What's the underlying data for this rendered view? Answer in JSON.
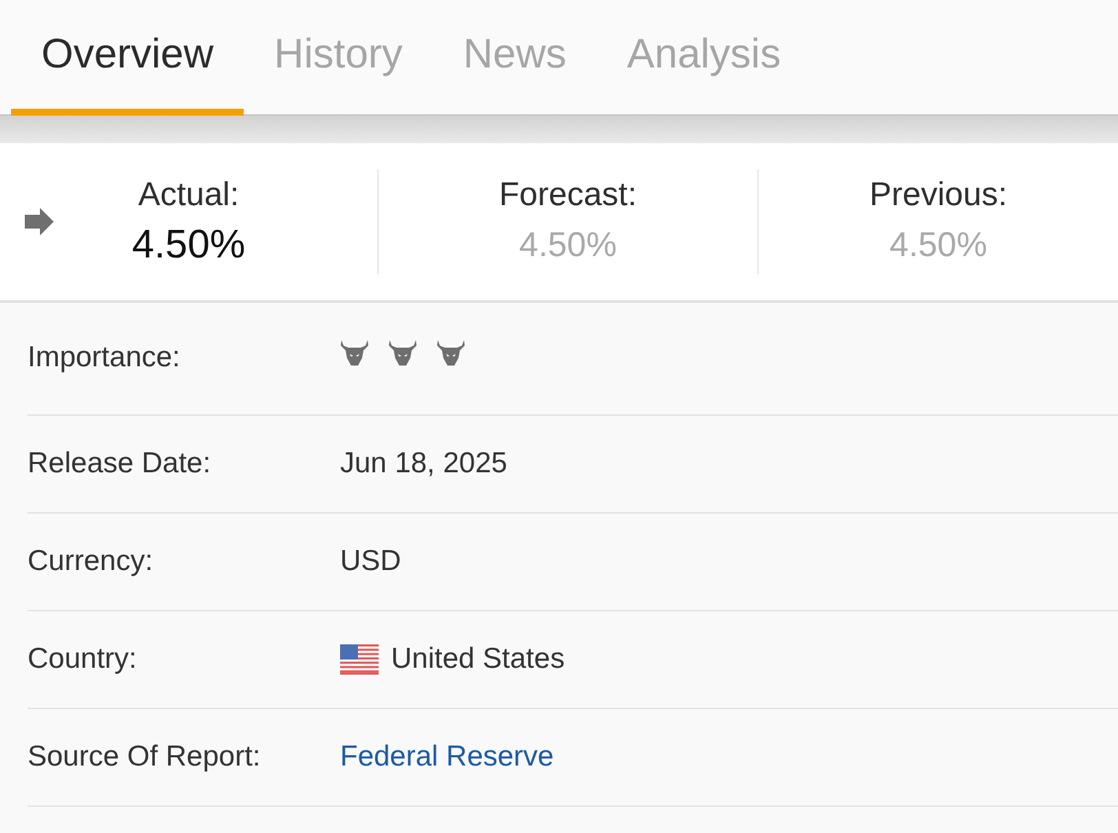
{
  "tabs": [
    {
      "label": "Overview",
      "selected": true
    },
    {
      "label": "History",
      "selected": false
    },
    {
      "label": "News",
      "selected": false
    },
    {
      "label": "Analysis",
      "selected": false
    }
  ],
  "summary": [
    {
      "kind": "actual",
      "label": "Actual:",
      "value": "4.50%"
    },
    {
      "kind": "estimate",
      "label": "Forecast:",
      "value": "4.50%"
    },
    {
      "kind": "estimate",
      "label": "Previous:",
      "value": "4.50%"
    }
  ],
  "details": [
    {
      "kind": "rating",
      "label": "Importance:",
      "stars": 3
    },
    {
      "kind": "text",
      "label": "Release Date:",
      "value": "Jun 18, 2025"
    },
    {
      "kind": "text",
      "label": "Currency:",
      "value": "USD"
    },
    {
      "kind": "country",
      "label": "Country:",
      "value": "United States"
    },
    {
      "kind": "link",
      "label": "Source Of Report:",
      "value": "Federal Reserve"
    }
  ]
}
